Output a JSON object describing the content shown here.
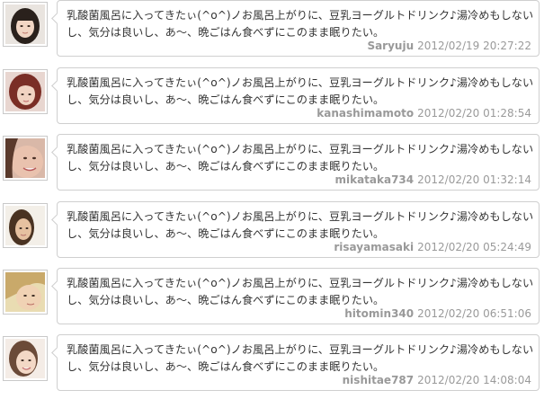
{
  "posts": [
    {
      "text": "乳酸菌風呂に入ってきたぃ(^o^)ノお風呂上がりに、豆乳ヨーグルトドリンク♪湯冷めもしないし、気分は良いし、あ〜、晩ごはん食べずにこのまま眠りたい。",
      "user": "Saryuju",
      "timestamp": "2012/02/19 20:27:22"
    },
    {
      "text": "乳酸菌風呂に入ってきたぃ(^o^)ノお風呂上がりに、豆乳ヨーグルトドリンク♪湯冷めもしないし、気分は良いし、あ〜、晩ごはん食べずにこのまま眠りたい。",
      "user": "kanashimamoto",
      "timestamp": "2012/02/20 01:28:54"
    },
    {
      "text": "乳酸菌風呂に入ってきたぃ(^o^)ノお風呂上がりに、豆乳ヨーグルトドリンク♪湯冷めもしないし、気分は良いし、あ〜、晩ごはん食べずにこのまま眠りたい。",
      "user": "mikataka734",
      "timestamp": "2012/02/20 01:32:14"
    },
    {
      "text": "乳酸菌風呂に入ってきたぃ(^o^)ノお風呂上がりに、豆乳ヨーグルトドリンク♪湯冷めもしないし、気分は良いし、あ〜、晩ごはん食べずにこのまま眠りたい。",
      "user": "risayamasaki",
      "timestamp": "2012/02/20 05:24:49"
    },
    {
      "text": "乳酸菌風呂に入ってきたぃ(^o^)ノお風呂上がりに、豆乳ヨーグルトドリンク♪湯冷めもしないし、気分は良いし、あ〜、晩ごはん食べずにこのまま眠りたい。",
      "user": "hitomin340",
      "timestamp": "2012/02/20 06:51:06"
    },
    {
      "text": "乳酸菌風呂に入ってきたぃ(^o^)ノお風呂上がりに、豆乳ヨーグルトドリンク♪湯冷めもしないし、気分は良いし、あ〜、晩ごはん食べずにこのまま眠りたい。",
      "user": "nishitae787",
      "timestamp": "2012/02/20 14:08:04"
    }
  ]
}
